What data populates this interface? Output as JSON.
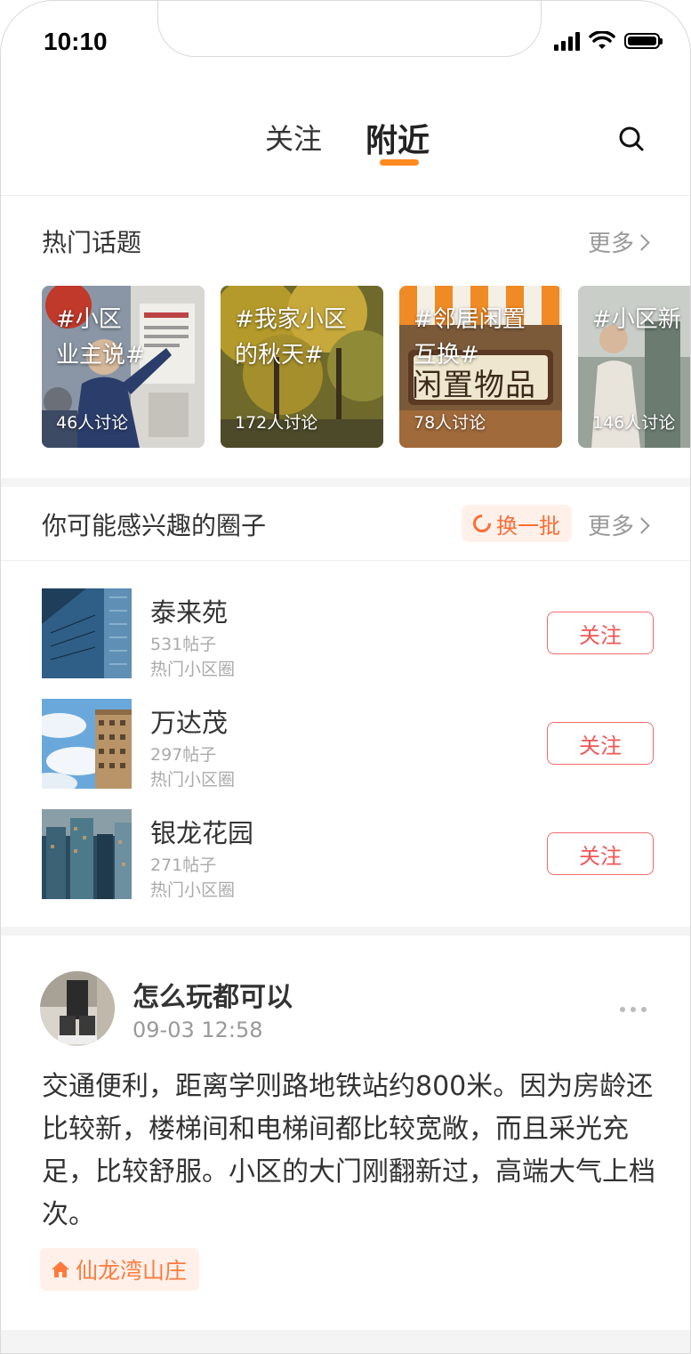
{
  "status_bar": {
    "time": "10:10"
  },
  "nav": {
    "tabs": [
      "关注",
      "附近"
    ]
  },
  "hot_topics": {
    "title": "热门话题",
    "more": "更多",
    "items": [
      {
        "title": "#小区\n业主说#",
        "count": "46人讨论"
      },
      {
        "title": "#我家小区\n的秋天#",
        "count": "172人讨论"
      },
      {
        "title": "#邻居闲置\n互换#",
        "count": "78人讨论",
        "image_text": "闲置物品"
      },
      {
        "title": "#小区新",
        "count": "146人讨论"
      }
    ]
  },
  "circles": {
    "title": "你可能感兴趣的圈子",
    "refresh": "换一批",
    "more": "更多",
    "items": [
      {
        "name": "泰来苑",
        "posts": "531帖子",
        "type": "热门小区圈",
        "action": "关注"
      },
      {
        "name": "万达茂",
        "posts": "297帖子",
        "type": "热门小区圈",
        "action": "关注"
      },
      {
        "name": "银龙花园",
        "posts": "271帖子",
        "type": "热门小区圈",
        "action": "关注"
      }
    ]
  },
  "post": {
    "author": "怎么玩都可以",
    "time": "09-03 12:58",
    "content": "交通便利，距离学则路地铁站约800米。因为房龄还比较新，楼梯间和电梯间都比较宽敞，而且采光充足，比较舒服。小区的大门刚翻新过，高端大气上档次。",
    "tag": "仙龙湾山庄"
  },
  "colors": {
    "accent": "#ff8a1f",
    "follow_red": "#f15656",
    "tag_orange": "#ff7a3d"
  }
}
